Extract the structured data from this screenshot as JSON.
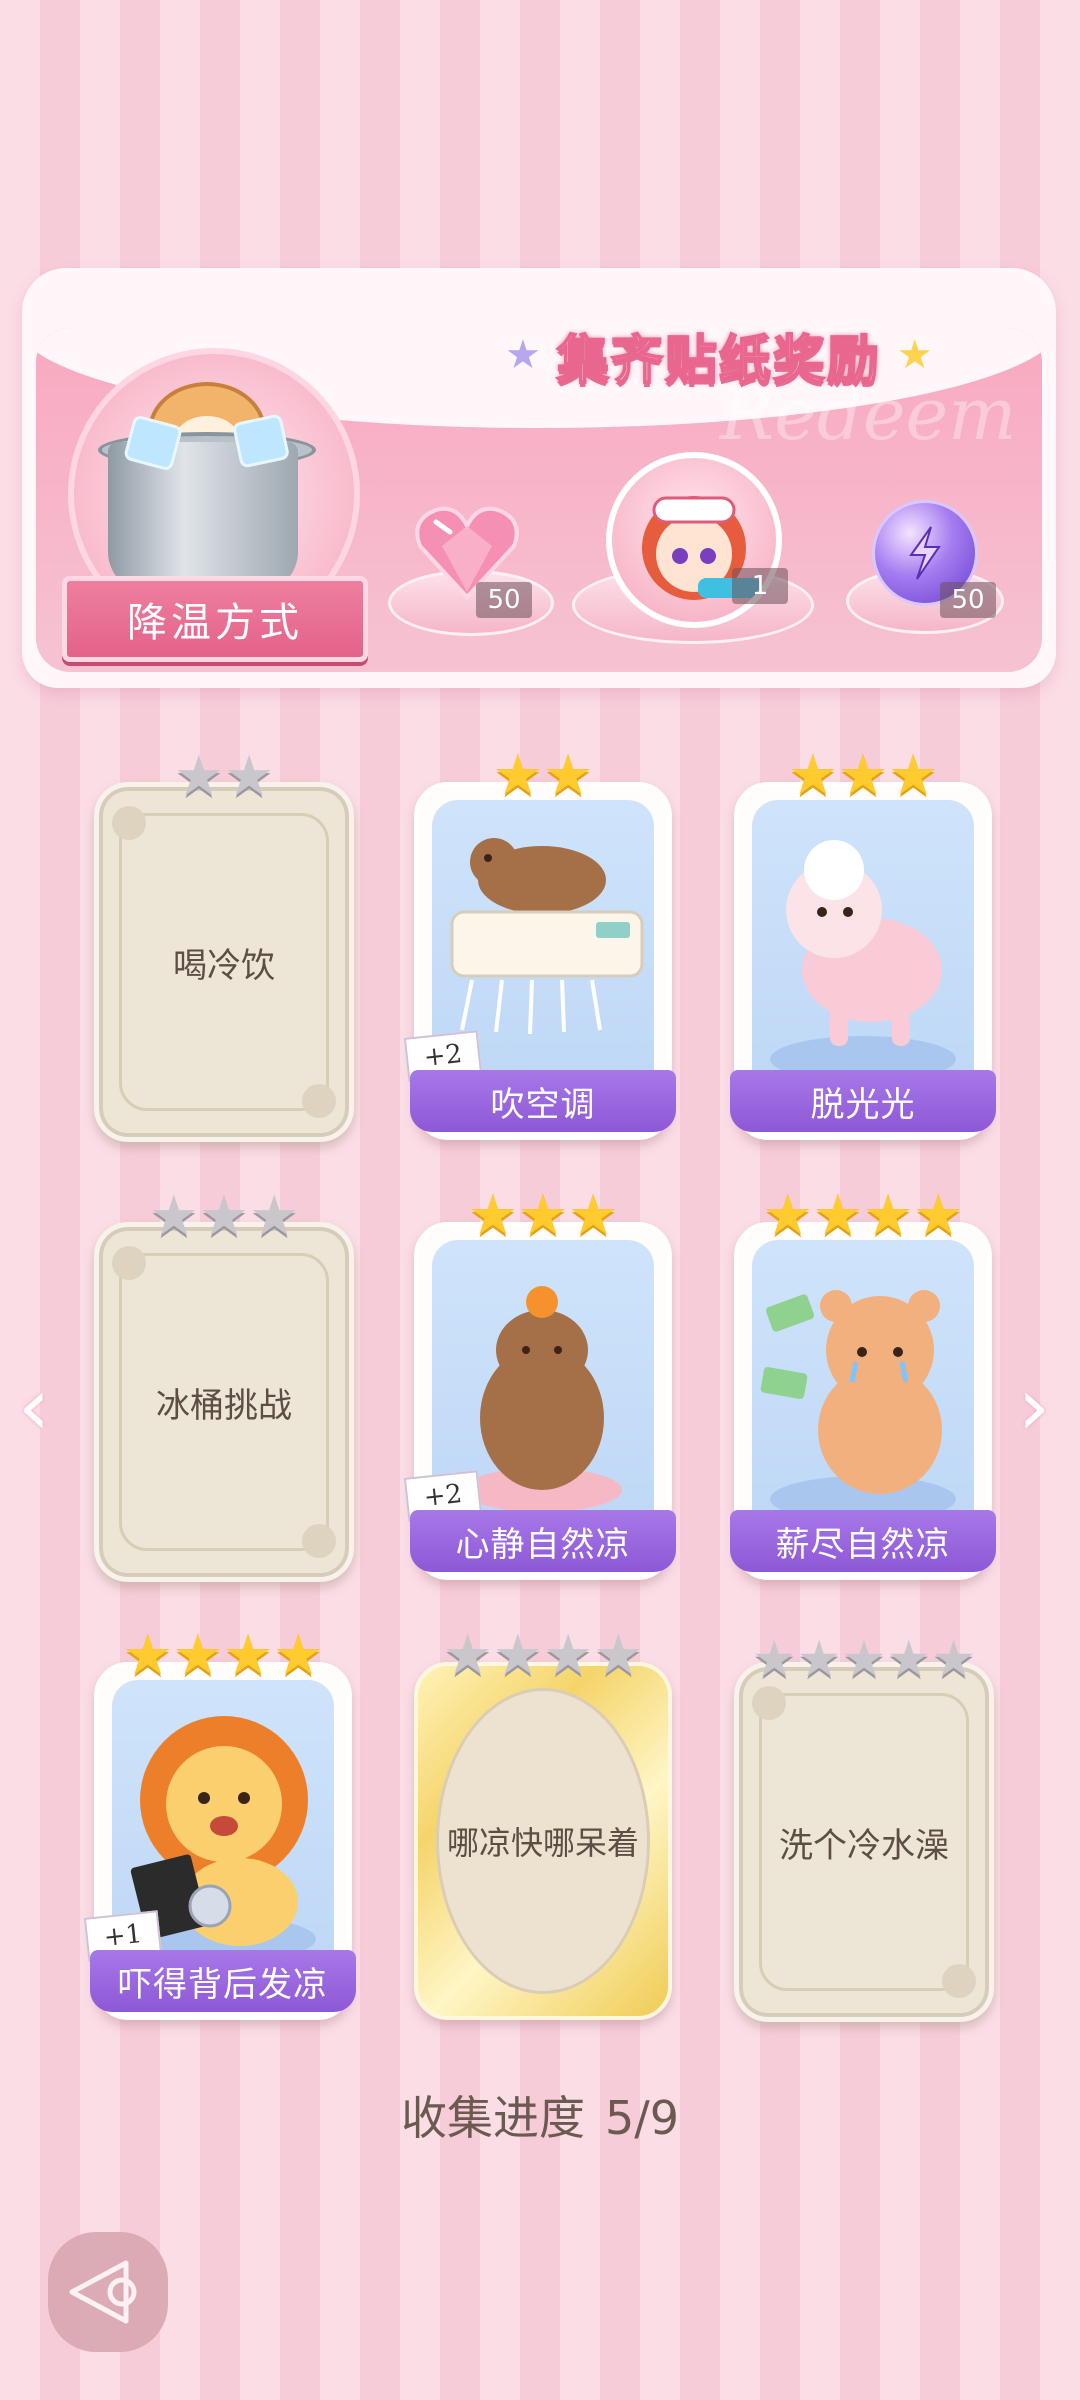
{
  "banner": {
    "title": "集齐贴纸奖励",
    "watermark": "Redeem",
    "category_label": "降温方式",
    "rewards": [
      {
        "icon": "pink-heart-gem-icon",
        "count": "50"
      },
      {
        "icon": "girl-avatar-icon",
        "count": "1"
      },
      {
        "icon": "purple-lightning-orb-icon",
        "count": "50"
      }
    ]
  },
  "cards": [
    {
      "name": "喝冷饮",
      "state": "locked",
      "stars_filled": 0,
      "stars_total": 2,
      "bonus": ""
    },
    {
      "name": "吹空调",
      "state": "collected",
      "stars_filled": 2,
      "stars_total": 2,
      "bonus": "+2",
      "art": "capybara-aircon"
    },
    {
      "name": "脱光光",
      "state": "collected",
      "stars_filled": 3,
      "stars_total": 3,
      "bonus": "",
      "art": "sheep"
    },
    {
      "name": "冰桶挑战",
      "state": "locked",
      "stars_filled": 0,
      "stars_total": 3,
      "bonus": ""
    },
    {
      "name": "心静自然凉",
      "state": "collected",
      "stars_filled": 3,
      "stars_total": 3,
      "bonus": "+2",
      "art": "capybara-meditate"
    },
    {
      "name": "薪尽自然凉",
      "state": "collected",
      "stars_filled": 4,
      "stars_total": 4,
      "bonus": "",
      "art": "bear-crying"
    },
    {
      "name": "吓得背后发凉",
      "state": "collected",
      "stars_filled": 4,
      "stars_total": 4,
      "bonus": "+1",
      "art": "lion-scared"
    },
    {
      "name": "哪凉快哪呆着",
      "state": "locked-gold",
      "stars_filled": 0,
      "stars_total": 4,
      "bonus": ""
    },
    {
      "name": "洗个冷水澡",
      "state": "locked",
      "stars_filled": 0,
      "stars_total": 5,
      "bonus": ""
    }
  ],
  "progress": {
    "label": "收集进度",
    "value": "5/9",
    "collected": 5,
    "total": 9
  },
  "colors": {
    "name_bar": "#9a66e0",
    "gold_star": "#ffcb2f",
    "grey_star": "#c9c7cc",
    "stripe_light": "#fbdde6",
    "stripe_dark": "#f7ccd9"
  },
  "nav": {
    "prev_icon": "chevron-left-icon",
    "next_icon": "chevron-right-icon",
    "back_icon": "back-arrow-icon"
  }
}
